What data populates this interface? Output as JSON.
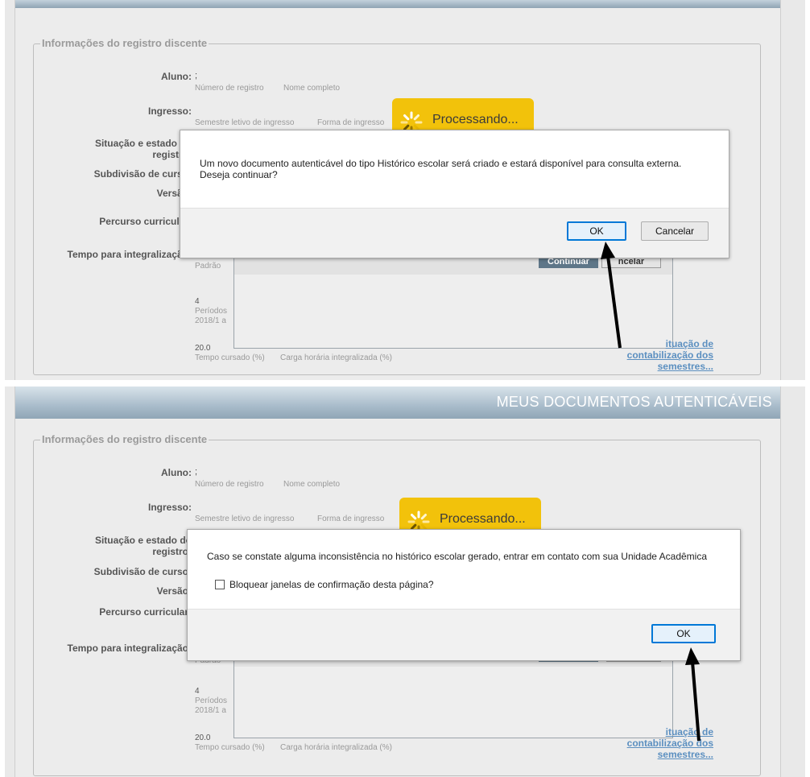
{
  "screen1": {
    "legend": "Informações do registro discente",
    "labels": {
      "aluno": "Aluno:",
      "ingresso": "Ingresso:",
      "situacao_line1": "Situação e estado do",
      "situacao_line2": "registro:",
      "subdivisao": "Subdivisão de curso:",
      "versao": "Versão:",
      "percurso": "Percurso curricular:",
      "tempo": "Tempo para integralização:"
    },
    "values": {
      "aluno_sep": ";",
      "numero_registro": "Número de registro",
      "nome_completo": "Nome completo",
      "semestre_ingresso": "Semestre letivo de ingresso",
      "forma_ingresso": "Forma de ingresso",
      "padrao": "Padrão",
      "periodos_num": "4",
      "periodos": "Períodos",
      "periodo_range": "2018/1 a",
      "tempo_val": "20.0",
      "tempo_cursado": "Tempo cursado (%)",
      "carga_horaria": "Carga horária integralizada (%)"
    },
    "inner": {
      "continuar": "Continuar",
      "cancelar": "ncelar"
    },
    "link": {
      "line1": "ituação de",
      "line2": "contabilização dos",
      "line3": "semestres..."
    },
    "processing": "Processando...",
    "dialog": {
      "message": "Um novo documento autenticável do tipo Histórico escolar será criado e estará disponível para consulta externa. Deseja continuar?",
      "ok": "OK",
      "cancel": "Cancelar"
    }
  },
  "screen2": {
    "header_title": "MEUS DOCUMENTOS AUTENTICÁVEIS",
    "legend": "Informações do registro discente",
    "labels": {
      "aluno": "Aluno:",
      "ingresso": "Ingresso:",
      "situacao_line1": "Situação e estado do",
      "situacao_line2": "registro:",
      "subdivisao": "Subdivisão de curso:",
      "versao": "Versão:",
      "percurso": "Percurso curricular:",
      "tempo": "Tempo para integralização:"
    },
    "values": {
      "aluno_sep": ";",
      "numero_registro": "Número de registro",
      "nome_completo": "Nome completo",
      "semestre_ingresso": "Semestre letivo de ingresso",
      "forma_ingresso": "Forma de ingresso",
      "padrao": "Padrão",
      "periodos_num": "4",
      "periodos": "Períodos",
      "periodo_range": "2018/1 a",
      "tempo_val": "20.0",
      "tempo_cursado": "Tempo cursado (%)",
      "carga_horaria": "Carga horária integralizada (%)"
    },
    "link": {
      "line1": "ituação de",
      "line2": "contabilização dos",
      "line3": "semestres..."
    },
    "processing": "Processando...",
    "dialog": {
      "message": "Caso se constate alguma inconsistência no histórico escolar gerado, entrar em contato com sua Unidade Acadêmica",
      "checkbox_label": "Bloquear janelas de confirmação desta página?",
      "ok": "OK"
    }
  },
  "colors": {
    "header": "#90a6b6",
    "processing": "#f2c20b",
    "link": "#5b8fc0",
    "focus_border": "#0078d7",
    "arrow": "#000000"
  }
}
